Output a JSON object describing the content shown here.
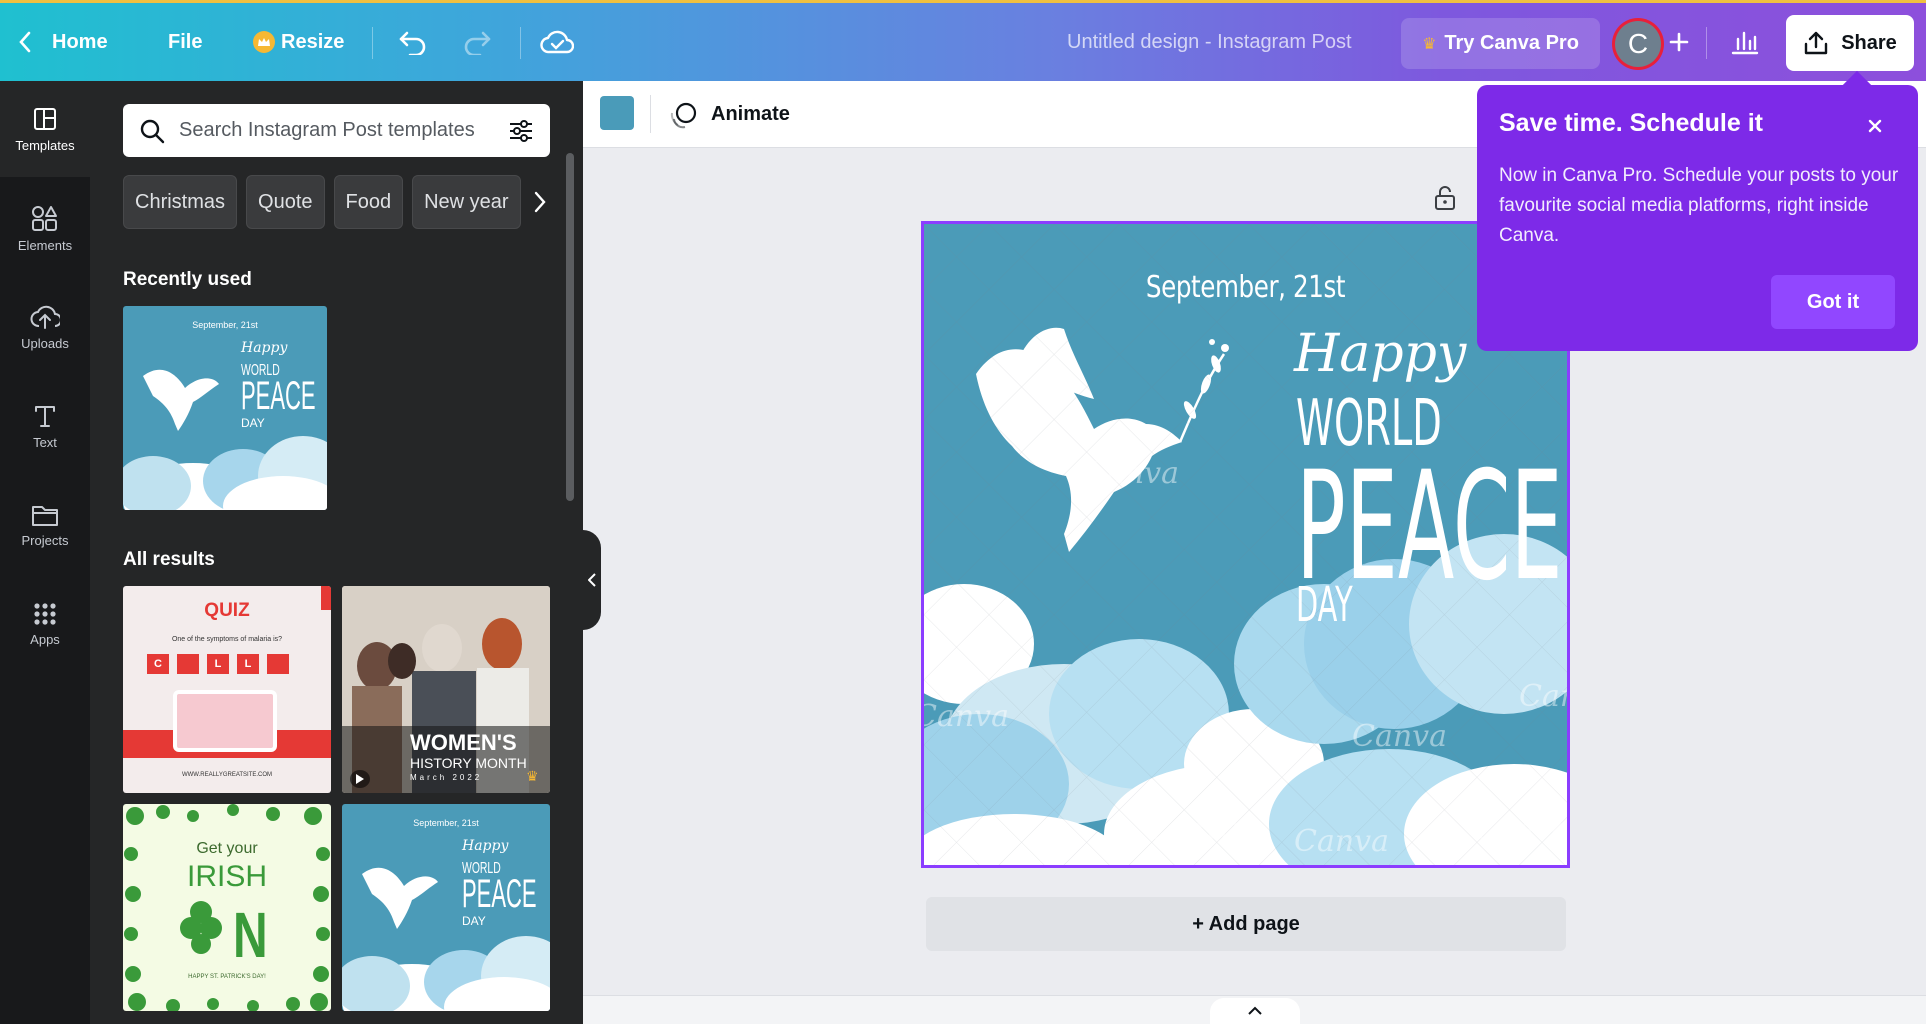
{
  "topbar": {
    "home_label": "Home",
    "file_label": "File",
    "resize_label": "Resize",
    "doc_title": "Untitled design - Instagram Post",
    "try_pro_label": "Try Canva Pro",
    "avatar_initial": "C",
    "share_label": "Share"
  },
  "rail": {
    "items": [
      {
        "label": "Templates",
        "icon": "templates-icon"
      },
      {
        "label": "Elements",
        "icon": "elements-icon"
      },
      {
        "label": "Uploads",
        "icon": "uploads-icon"
      },
      {
        "label": "Text",
        "icon": "text-icon"
      },
      {
        "label": "Projects",
        "icon": "projects-icon"
      },
      {
        "label": "Apps",
        "icon": "apps-icon"
      }
    ]
  },
  "panel": {
    "search_placeholder": "Search Instagram Post templates",
    "chips": [
      "Christmas",
      "Quote",
      "Food",
      "New year"
    ],
    "recently_used_title": "Recently used",
    "all_results_title": "All results",
    "thumbnails": {
      "peace_date": "September, 21st",
      "peace_happy": "Happy",
      "peace_world": "WORLD",
      "peace_peace": "PEACE",
      "peace_day": "DAY",
      "quiz_title": "QUIZ",
      "quiz_question": "One of the symptoms of malaria is?",
      "quiz_letters": [
        "C",
        "",
        "L",
        "L",
        ""
      ],
      "quiz_footer": "WWW.REALLYGREATSITE.COM",
      "women_line1": "WOMEN'S",
      "women_line2": "HISTORY MONTH",
      "women_line3": "March 2022",
      "irish_line1": "Get your",
      "irish_line2": "IRISH",
      "irish_letter": "N",
      "irish_footer": "HAPPY ST. PATRICK'S DAY!"
    }
  },
  "toolbar": {
    "color_swatch": "#4a9bb9",
    "animate_label": "Animate"
  },
  "design": {
    "background": "#4b9bb8",
    "date": "September, 21st",
    "happy": "Happy",
    "world": "WORLD",
    "peace": "PEACE",
    "day": "DAY",
    "watermark": "Canva"
  },
  "add_page_label": "+ Add page",
  "popover": {
    "title": "Save time. Schedule it",
    "body": "Now in Canva Pro. Schedule your posts to your favourite social media platforms, right inside Canva.",
    "button_label": "Got it"
  },
  "colors": {
    "accent_purple": "#7d2ae8",
    "selection": "#8b3dff",
    "design_blue": "#4b9bb8"
  }
}
